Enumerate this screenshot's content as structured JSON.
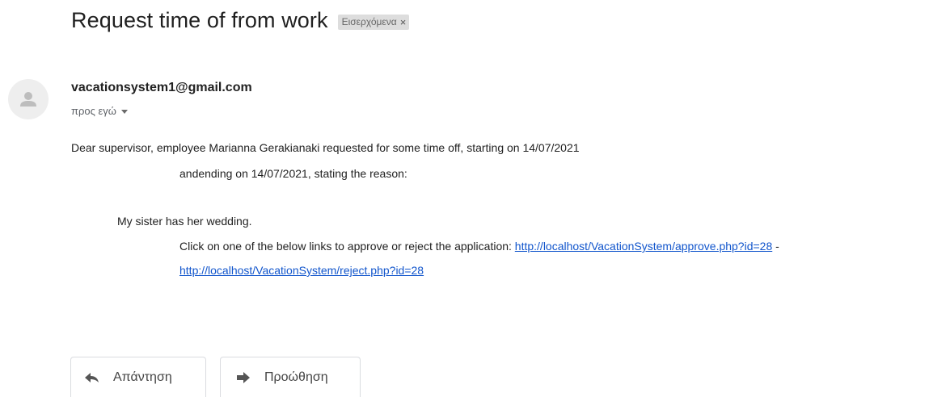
{
  "email": {
    "subject": "Request time of from work",
    "label_chip": {
      "text": "Εισερχόμενα",
      "remove_symbol": "×"
    },
    "sender": "vacationsystem1@gmail.com",
    "recipient": "προς εγώ",
    "body": {
      "line1": "Dear supervisor, employee Marianna Gerakianaki requested for some time off, starting on 14/07/2021",
      "line2": "andending on 14/07/2021, stating the reason:",
      "line3": "My sister has her wedding.",
      "line4_text": "Click on one of the below links to approve or reject the application: ",
      "approve_link": "http://localhost/VacationSystem/approve.php?id=28",
      "line4_separator": " -",
      "reject_link": "http://localhost/VacationSystem/reject.php?id=28"
    }
  },
  "actions": {
    "reply_label": "Απάντηση",
    "forward_label": "Προώθηση"
  },
  "icons": {
    "avatar": "person-silhouette-icon",
    "reply": "reply-arrow-icon",
    "forward": "forward-arrow-icon",
    "recipient_details": "caret-down-icon"
  },
  "colors": {
    "link": "#1155cc",
    "chip_background": "#dddddd",
    "avatar_background": "#eeeeee"
  }
}
